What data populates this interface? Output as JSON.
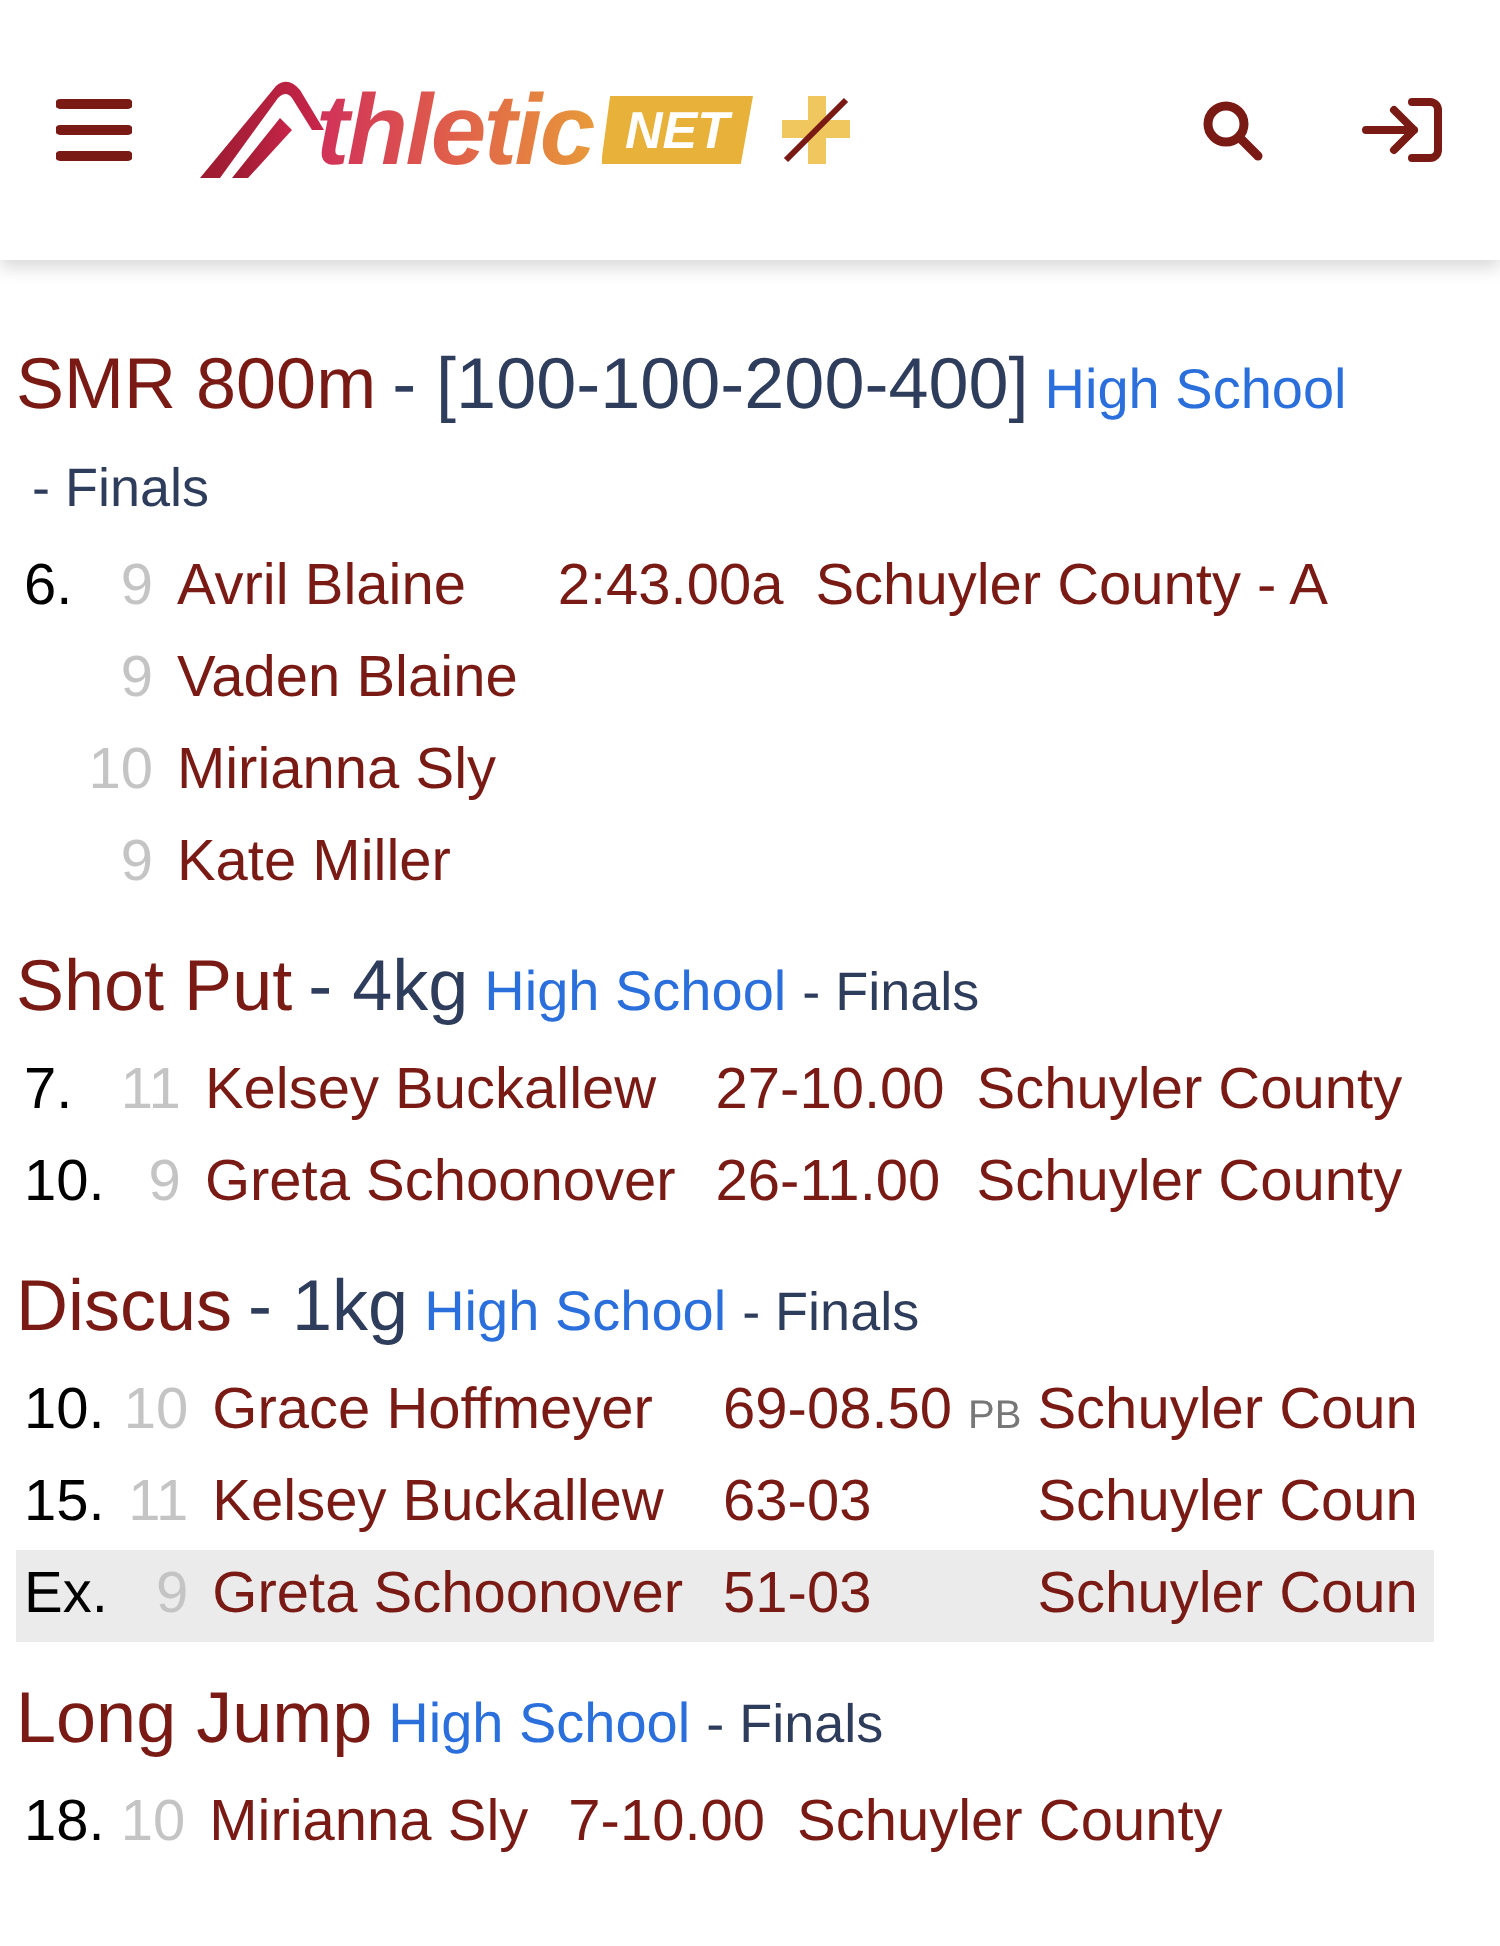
{
  "header": {
    "logo": {
      "word": "thletic",
      "badge": "NET"
    }
  },
  "sections": [
    {
      "event": "SMR 800m",
      "detail": "- [100-100-200-400]",
      "level": "High School",
      "round": "- Finals",
      "rows": [
        {
          "place": "6.",
          "grade": "9",
          "athlete": "Avril Blaine",
          "mark": "2:43.00a",
          "team": "Schuyler County - A",
          "highlighted": false
        },
        {
          "grade": "9",
          "athlete": "Vaden Blaine",
          "highlighted": false
        },
        {
          "grade": "10",
          "athlete": "Mirianna Sly",
          "highlighted": false
        },
        {
          "grade": "9",
          "athlete": "Kate Miller",
          "highlighted": false
        }
      ]
    },
    {
      "event": "Shot Put",
      "detail": "- 4kg",
      "level": "High School",
      "round": "- Finals",
      "rows": [
        {
          "place": "7.",
          "grade": "11",
          "athlete": "Kelsey Buckallew",
          "mark": "27-10.00",
          "team": "Schuyler County",
          "highlighted": false
        },
        {
          "place": "10.",
          "grade": "9",
          "athlete": "Greta Schoonover",
          "mark": "26-11.00",
          "team": "Schuyler County",
          "highlighted": false
        }
      ]
    },
    {
      "event": "Discus",
      "detail": "- 1kg",
      "level": "High School",
      "round": "- Finals",
      "rows": [
        {
          "place": "10.",
          "grade": "10",
          "athlete": "Grace Hoffmeyer",
          "mark": "69-08.50",
          "pb": "PB",
          "team": "Schuyler Coun",
          "highlighted": false
        },
        {
          "place": "15.",
          "grade": "11",
          "athlete": "Kelsey Buckallew",
          "mark": "63-03",
          "team": "Schuyler Coun",
          "highlighted": false
        },
        {
          "place": "Ex.",
          "grade": "9",
          "athlete": "Greta Schoonover",
          "mark": "51-03",
          "team": "Schuyler Coun",
          "highlighted": true
        }
      ]
    },
    {
      "event": "Long Jump",
      "level": "High School",
      "round": "- Finals",
      "rows": [
        {
          "place": "18.",
          "grade": "10",
          "athlete": "Mirianna Sly",
          "mark": "7-10.00",
          "team": "Schuyler County",
          "highlighted": false
        }
      ]
    }
  ]
}
